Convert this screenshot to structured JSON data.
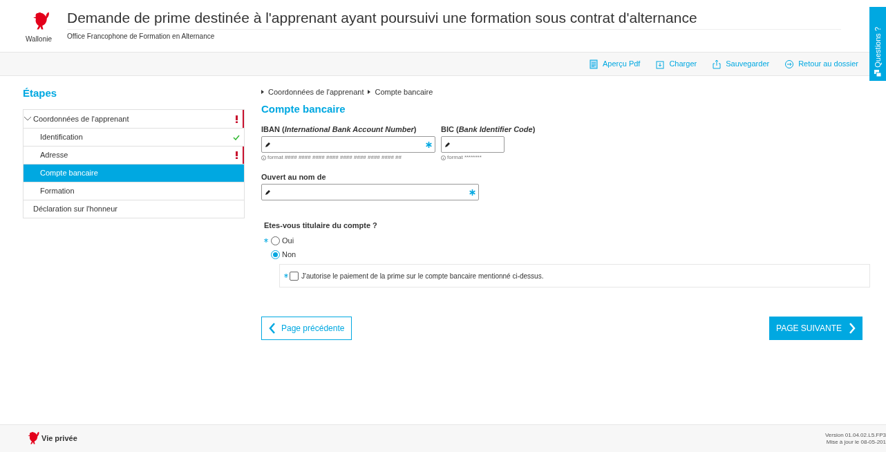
{
  "header": {
    "logo_caption": "Wallonie",
    "title": "Demande de prime destinée à l'apprenant ayant poursuivi une formation sous contrat d'alternance",
    "subtitle": "Office Francophone de Formation en Alternance"
  },
  "toolbar": [
    {
      "kind": "pdf",
      "label": "Aperçu Pdf"
    },
    {
      "kind": "load",
      "label": "Charger"
    },
    {
      "kind": "save",
      "label": "Sauvegarder"
    },
    {
      "kind": "back",
      "label": "Retour au dossier"
    }
  ],
  "side_tab": {
    "label": "Questions ?"
  },
  "sidebar": {
    "title": "Étapes",
    "items": [
      {
        "label": "Coordonnées de l'apprenant",
        "error": true,
        "done": false,
        "selected": false,
        "expanded": true,
        "children": [
          {
            "label": "Identification",
            "error": false,
            "done": true,
            "selected": false
          },
          {
            "label": "Adresse",
            "error": true,
            "done": false,
            "selected": false
          },
          {
            "label": "Compte bancaire",
            "error": false,
            "done": false,
            "selected": true
          },
          {
            "label": "Formation",
            "error": false,
            "done": false,
            "selected": false
          }
        ]
      },
      {
        "label": "Déclaration sur l'honneur",
        "error": false,
        "done": false,
        "selected": false
      }
    ]
  },
  "breadcrumb": [
    "Coordonnées de l'apprenant",
    "Compte bancaire"
  ],
  "form": {
    "title": "Compte bancaire",
    "iban": {
      "label": "IBAN **(*International Bank Account Number*)**",
      "required": true,
      "hint": "format #### #### #### #### #### #### #### #### ##"
    },
    "bic": {
      "label": "BIC  **(*Bank Identifier Code*)**",
      "required": false,
      "hint": "format ********"
    },
    "holder": {
      "label": "Ouvert au nom de",
      "required": true
    },
    "question": {
      "label": "Etes-vous titulaire du compte ?",
      "required": true,
      "options": [
        {
          "label": "Oui",
          "selected": false
        },
        {
          "label": "Non",
          "selected": true
        }
      ]
    },
    "consent": {
      "label": "J'autorise le paiement de la prime sur le compte bancaire mentionné ci-dessus.",
      "required": true,
      "checked": false
    }
  },
  "nav": {
    "previous": "Page précédente",
    "next": "PAGE SUIVANTE"
  },
  "footer": {
    "link": "Vie privée",
    "version": "Version 01.04.02.L5.FP3",
    "updated": "Mise à jour le 08-05-201"
  }
}
